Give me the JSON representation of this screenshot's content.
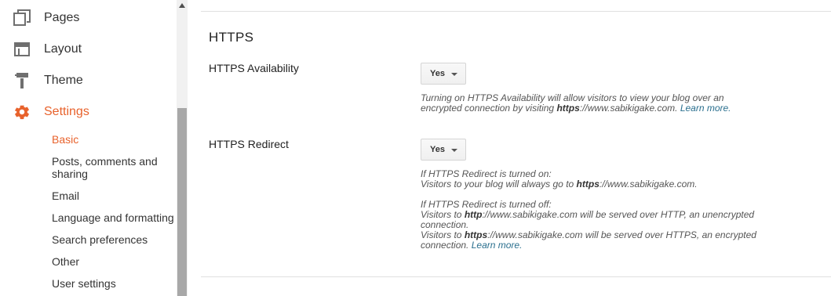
{
  "sidebar": {
    "items": [
      {
        "label": "Pages",
        "icon": "pages-icon"
      },
      {
        "label": "Layout",
        "icon": "layout-icon"
      },
      {
        "label": "Theme",
        "icon": "theme-icon"
      },
      {
        "label": "Settings",
        "icon": "settings-gear-icon"
      }
    ],
    "settings_subitems": [
      {
        "label": "Basic"
      },
      {
        "label": "Posts, comments and sharing"
      },
      {
        "label": "Email"
      },
      {
        "label": "Language and formatting"
      },
      {
        "label": "Search preferences"
      },
      {
        "label": "Other"
      },
      {
        "label": "User settings"
      }
    ]
  },
  "colors": {
    "accent": "#e8622c",
    "link": "#2a6f8e",
    "scroll_thumb": "#a8a8a8"
  },
  "main": {
    "section_title": "HTTPS",
    "availability": {
      "label": "HTTPS Availability",
      "value": "Yes",
      "help_line1_a": "Turning on HTTPS Availability will allow visitors to view your blog over an",
      "help_line2_a": "encrypted connection by visiting ",
      "help_line2_bold": "https",
      "help_line2_b": "://www.sabikigake.com. ",
      "learn_more": "Learn more."
    },
    "redirect": {
      "label": "HTTPS Redirect",
      "value": "Yes",
      "on_heading": "If HTTPS Redirect is turned on:",
      "on_line_a": "Visitors to your blog will always go to ",
      "on_line_bold": "https",
      "on_line_b": "://www.sabikigake.com.",
      "off_heading": "If HTTPS Redirect is turned off:",
      "off1_a": "Visitors to ",
      "off1_bold": "http",
      "off1_b": "://www.sabikigake.com will be served over HTTP, an unencrypted",
      "off1_c": "connection.",
      "off2_a": "Visitors to ",
      "off2_bold": "https",
      "off2_b": "://www.sabikigake.com will be served over HTTPS, an encrypted",
      "off2_c": "connection. ",
      "learn_more": "Learn more."
    }
  }
}
